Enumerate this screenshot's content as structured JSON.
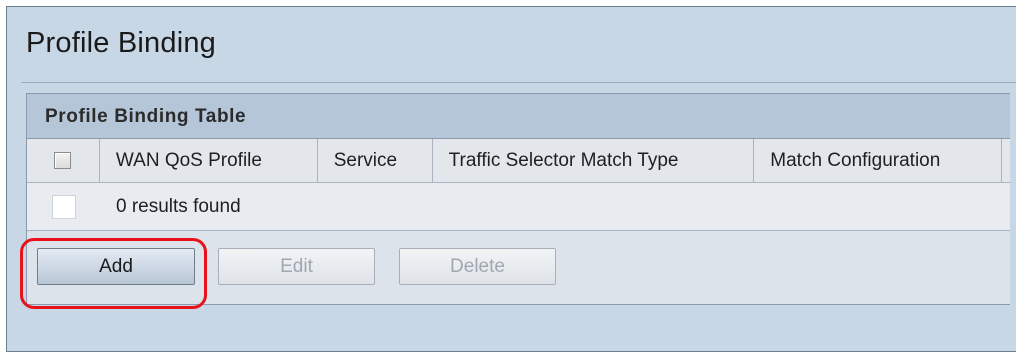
{
  "page": {
    "title": "Profile Binding"
  },
  "table": {
    "title": "Profile Binding Table",
    "columns": [
      "WAN QoS Profile",
      "Service",
      "Traffic Selector Match Type",
      "Match Configuration"
    ],
    "empty_message": "0 results found",
    "select_all_checked": false,
    "row_checked": false
  },
  "buttons": {
    "add": "Add",
    "edit": "Edit",
    "delete": "Delete"
  },
  "colors": {
    "highlight": "#e8121b",
    "header_bar": "#b4c6d8",
    "background": "#c7d7e6"
  }
}
